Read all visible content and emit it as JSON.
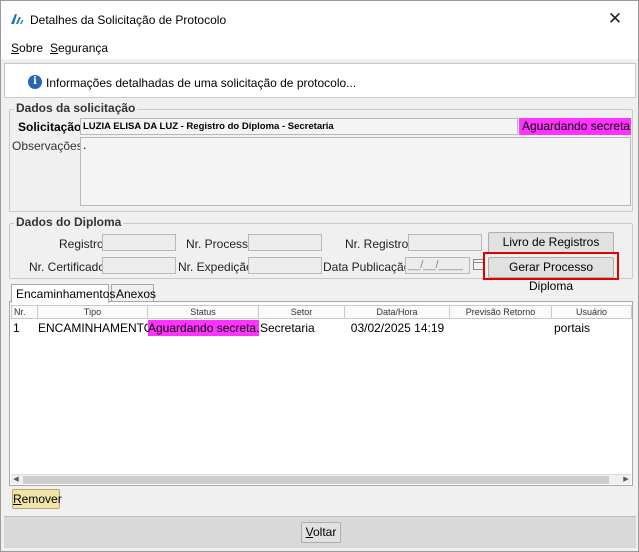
{
  "window": {
    "title": "Detalhes da Solicitação de Protocolo",
    "close_symbol": "✕"
  },
  "menu": {
    "items": [
      {
        "label_first": "S",
        "label_rest": "obre"
      },
      {
        "label_first": "S",
        "label_rest": "egurança"
      }
    ]
  },
  "info": {
    "icon_glyph": "i",
    "text": "Informações detalhadas de uma solicitação de protocolo..."
  },
  "solicitacao": {
    "group_label": "Dados da solicitação",
    "label": "Solicitação:",
    "value": "LUZIA ELISA DA LUZ - Registro do Diploma - Secretaria",
    "status": "Aguardando secretaria",
    "status_color": "#ff33ff",
    "obs_label": "Observações:",
    "obs_value": "."
  },
  "diploma": {
    "group_label": "Dados do Diploma",
    "registro_label": "Registro:",
    "nr_processo_label": "Nr. Processo:",
    "nr_registro_label": "Nr. Registro:",
    "nr_certificado_label": "Nr. Certificado:",
    "nr_expedicao_label": "Nr. Expedição:",
    "data_publicacao_label": "Data Publicação:",
    "data_publicacao_placeholder": "__/__/____",
    "livro_button": "Livro de Registros",
    "gerar_button": "Gerar Processo Diploma"
  },
  "tabs": [
    {
      "label": "Encaminhamentos",
      "active": true
    },
    {
      "label": "Anexos",
      "active": false
    }
  ],
  "grid": {
    "columns": [
      "Nr.",
      "Tipo",
      "Status",
      "Setor",
      "Data/Hora",
      "Previsão Retorno",
      "Usuário"
    ],
    "rows": [
      {
        "nr": "1",
        "tipo": "ENCAMINHAMENTO",
        "status": "Aguardando secreta...",
        "setor": "Secretaria",
        "data_hora": "03/02/2025 14:19",
        "previsao": "",
        "usuario": "portais"
      }
    ]
  },
  "remover_first": "R",
  "remover_rest": "emover",
  "voltar_first": "V",
  "voltar_rest": "oltar",
  "colors": {
    "accent_magenta": "#ff33ff",
    "highlight_red": "#e00000",
    "info_blue": "#2665b8",
    "remover_bg": "#f0e4a8"
  }
}
